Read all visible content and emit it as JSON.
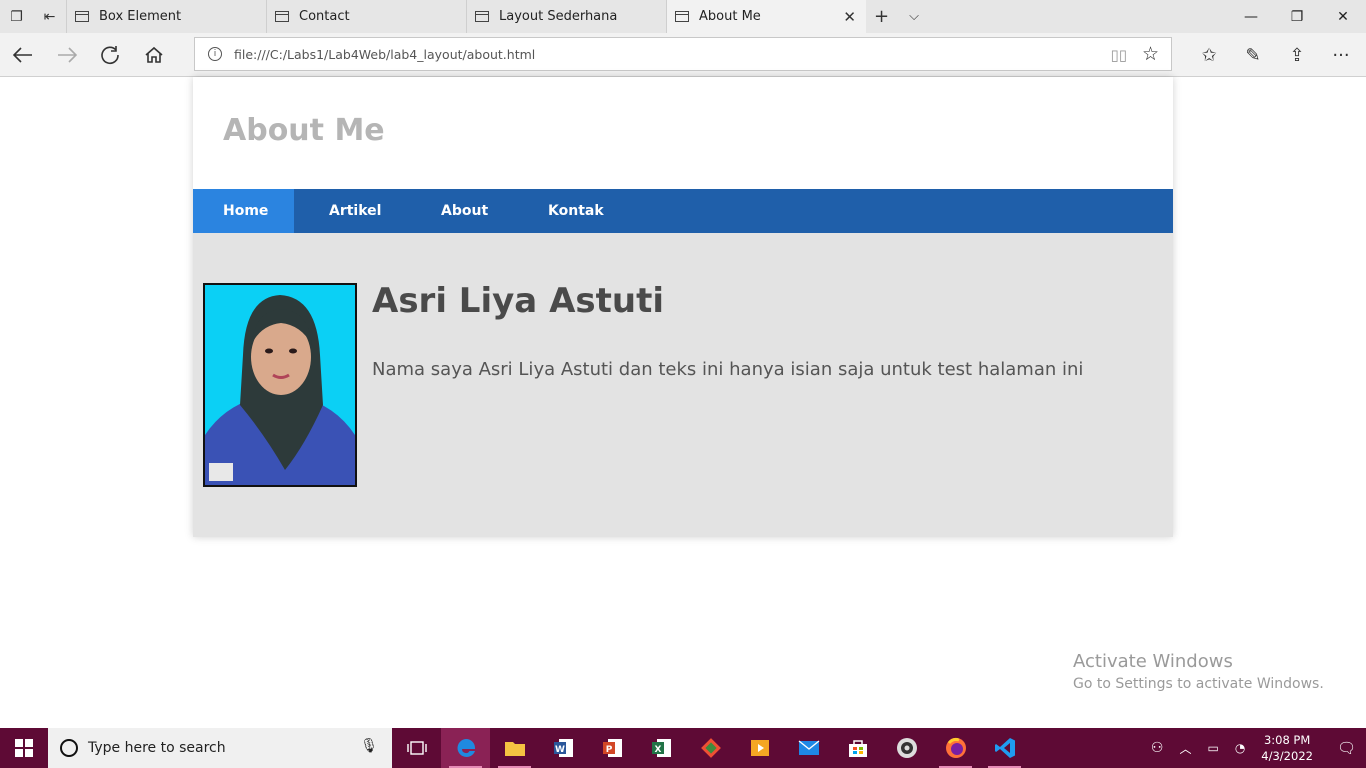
{
  "browser": {
    "tabs": [
      {
        "title": "Box Element"
      },
      {
        "title": "Contact"
      },
      {
        "title": "Layout Sederhana"
      },
      {
        "title": "About Me"
      }
    ],
    "address": "file:///C:/Labs1/Lab4Web/lab4_layout/about.html",
    "icons": {
      "back": "back-arrow-icon",
      "forward": "forward-arrow-icon",
      "refresh": "refresh-icon",
      "home": "home-icon"
    }
  },
  "page": {
    "site_title": "About Me",
    "menu": [
      {
        "label": "Home",
        "active": true
      },
      {
        "label": "Artikel"
      },
      {
        "label": "About"
      },
      {
        "label": "Kontak"
      }
    ],
    "profile": {
      "name": "Asri Liya Astuti",
      "description": "Nama saya Asri Liya Astuti dan teks ini hanya isian saja untuk test halaman ini"
    },
    "colors": {
      "nav": "#1f5faa",
      "nav_active": "#2b84e0",
      "content_bg": "#e3e3e3",
      "photo_bg": "#0bd0f5"
    }
  },
  "watermark": {
    "line1": "Activate Windows",
    "line2": "Go to Settings to activate Windows."
  },
  "taskbar": {
    "search_placeholder": "Type here to search",
    "time": "3:08 PM",
    "date": "4/3/2022"
  }
}
